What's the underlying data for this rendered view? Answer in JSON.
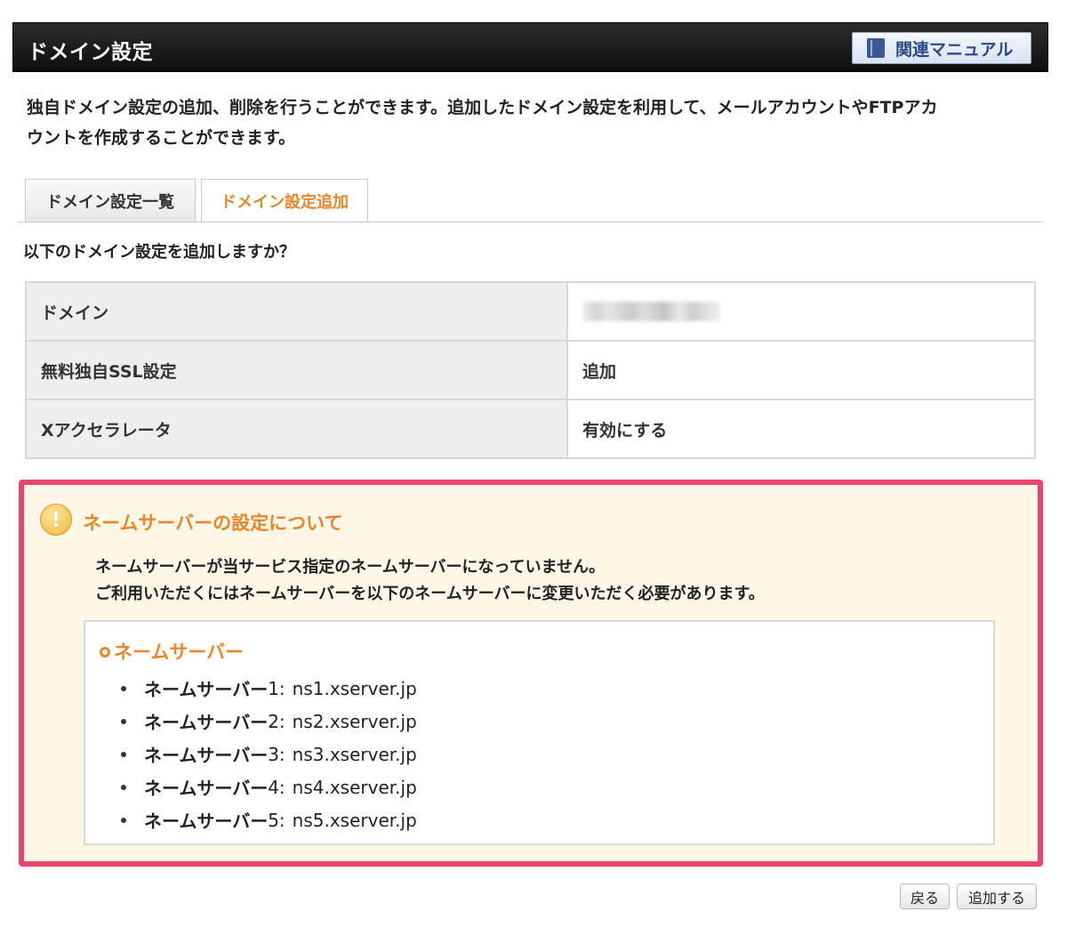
{
  "header": {
    "title": "ドメイン設定",
    "manual_label": "関連マニュアル"
  },
  "intro": {
    "line1": "独自ドメイン設定の追加、削除を行うことができます。追加したドメイン設定を利用して、メールアカウントやFTPアカ",
    "line2": "ウントを作成することができます。"
  },
  "tabs": [
    {
      "label": "ドメイン設定一覧"
    },
    {
      "label": "ドメイン設定追加"
    }
  ],
  "question": "以下のドメイン設定を追加しますか？",
  "table": [
    {
      "label": "ドメイン",
      "value": ""
    },
    {
      "label": "無料独自SSL設定",
      "value": "追加"
    },
    {
      "label": "Xアクセラレータ",
      "value": "有効にする"
    }
  ],
  "notice": {
    "icon": "!",
    "title": "ネームサーバーの設定について",
    "message_line1": "ネームサーバーが当サービス指定のネームサーバーになっていません。",
    "message_line2": "ご利用いただくにはネームサーバーを以下のネームサーバーに変更いただく必要があります。",
    "ns_heading": "ネームサーバー",
    "nameservers": [
      {
        "label": "ネームサーバー",
        "num": "1:",
        "host": "ns1.xserver.jp"
      },
      {
        "label": "ネームサーバー",
        "num": "2:",
        "host": "ns2.xserver.jp"
      },
      {
        "label": "ネームサーバー",
        "num": "3:",
        "host": "ns3.xserver.jp"
      },
      {
        "label": "ネームサーバー",
        "num": "4:",
        "host": "ns4.xserver.jp"
      },
      {
        "label": "ネームサーバー",
        "num": "5:",
        "host": "ns5.xserver.jp"
      }
    ]
  },
  "buttons": {
    "back": "戻る",
    "add": "追加する"
  },
  "colors": {
    "accent_orange": "#e8862a",
    "notice_border": "#e8466f",
    "notice_bg": "#fef7e8",
    "manual_text": "#2c4b86"
  }
}
